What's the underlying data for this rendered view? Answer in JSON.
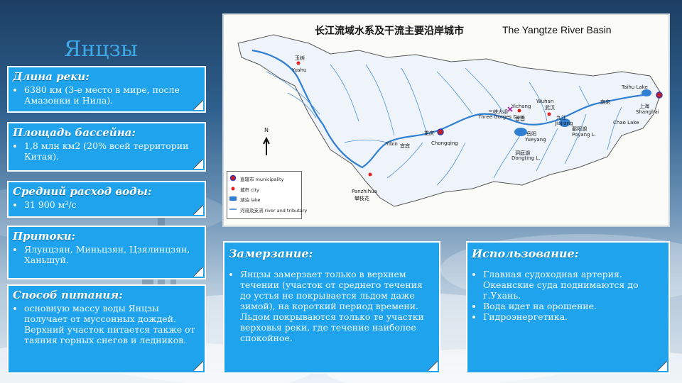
{
  "slide": {
    "title": "Янцзы"
  },
  "panels": {
    "length": {
      "heading": "Длина реки:",
      "items": [
        "6380 км (3-е место в мире, после Амазонки и Нила)."
      ]
    },
    "basin": {
      "heading": "Площадь бассейна:",
      "items": [
        "1,8 млн км2 (20% всей территории Китая)."
      ]
    },
    "flow": {
      "heading": "Средний расход воды:",
      "items": [
        "31 900 м³/с"
      ]
    },
    "tributaries": {
      "heading": "Притоки:",
      "items": [
        "Ялунцзян, Миньцзян, Цзялинцзян, Ханьшуй."
      ]
    },
    "feeding": {
      "heading": "Способ питания:",
      "items": [
        "основную массу воды Янцзы получает от муссонных дождей. Верхний участок питается также от таяния горных снегов и ледников."
      ]
    },
    "freezing": {
      "heading": "Замерзание:",
      "items": [
        "Янцзы замерзает только в верхнем течении (участок от среднего течения до устья не покрывается льдом даже зимой), на короткий период времени. Льдом покрываются только те участки верховья реки, где течение наиболее спокойное."
      ]
    },
    "usage": {
      "heading": "Использование:",
      "items": [
        "Главная судоходная артерия. Океанские суда поднимаются до г.Ухань.",
        "Вода идет на орошение.",
        "Гидроэнергетика."
      ]
    }
  },
  "map": {
    "title_cn": "长江流域水系及干流主要沿岸城市",
    "title_en": "The Yangtze River Basin",
    "north_label": "N",
    "cities": {
      "shanghai": "上海",
      "shanghai_en": "Shanghai",
      "chongqing": "重庆",
      "chongqing_en": "Chongqing",
      "yichang": "宜昌",
      "yichang_en": "Yichang",
      "wuhan": "武汉",
      "wuhan_en": "Wuhan",
      "yueyang": "岳阳",
      "yueyang_en": "Yueyang",
      "jiujiang": "九江",
      "jiujiang_en": "Jiujiang",
      "yibin": "宜宾",
      "yibin_en": "Yibin",
      "panzhihua": "攀枝花",
      "panzhihua_en": "Panzhihua",
      "yushu": "玉树",
      "yushu_en": "Yushu",
      "nanjing": "南京",
      "three_gorges": "三峡大坝",
      "three_gorges_en": "Three Gorges Dam",
      "dongting": "洞庭湖",
      "dongting_en": "Dongting L.",
      "poyang": "鄱阳湖",
      "poyang_en": "Poyang L.",
      "taihu": "Taihu Lake",
      "chaohu": "Chao Lake"
    },
    "legend": {
      "municipality": "直辖市 municipality",
      "city": "城市 city",
      "lake": "湖泊 lake",
      "river": "河流及支流 river and tributary"
    }
  },
  "colors": {
    "panel": "#1ea3ec",
    "title": "#3fa9e8",
    "river": "#2f7fd3"
  }
}
